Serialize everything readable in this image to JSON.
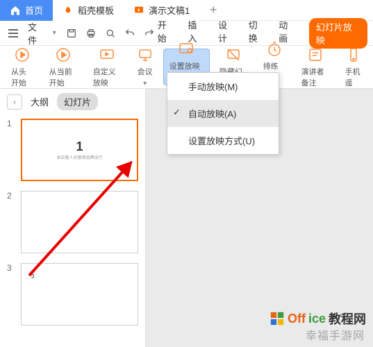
{
  "tabs": {
    "home": "首页",
    "docs": "稻壳模板",
    "pres": "演示文稿1",
    "add": "+"
  },
  "file_label": "文件",
  "menu": {
    "start": "开始",
    "insert": "插入",
    "design": "设计",
    "trans": "切换",
    "anim": "动画",
    "slideshow": "幻灯片放映"
  },
  "ribbon": {
    "fromstart": "从头开始",
    "fromcurrent": "从当前开始",
    "custom": "自定义放映",
    "meeting": "会议",
    "setmode": "设置放映方式",
    "hide": "隐藏幻灯片",
    "rehearse": "排练计时",
    "presenter": "演讲者备注",
    "phone": "手机遥"
  },
  "dropdown": {
    "manual": "手动放映(M)",
    "auto": "自动放映(A)",
    "settings": "设置放映方式(U)"
  },
  "outline": "大纲",
  "slides_label": "幻灯片",
  "slides": [
    {
      "n": "1",
      "title": "1",
      "sub": "本店客人员营销品牌设行"
    },
    {
      "n": "2",
      "title": "",
      "sub": ""
    },
    {
      "n": "3",
      "title": "3",
      "sub": ""
    }
  ],
  "brand": {
    "o": "Off",
    "mid": "ice",
    "tail": "教程网"
  },
  "watermark": "幸福手游网"
}
